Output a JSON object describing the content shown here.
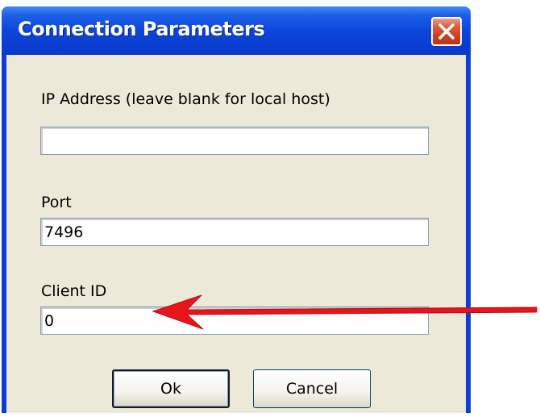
{
  "window": {
    "title": "Connection Parameters",
    "close_glyph": "✕"
  },
  "fields": {
    "ip_label": "IP Address (leave blank for local host)",
    "ip_value": "",
    "port_label": "Port",
    "port_value": "7496",
    "client_id_label": "Client ID",
    "client_id_value": "0"
  },
  "buttons": {
    "ok_label": "Ok",
    "cancel_label": "Cancel"
  },
  "annotation": {
    "arrow_color": "#e8141c",
    "points_to": "client-id-field"
  },
  "colors": {
    "titlebar": "#0a3ed6",
    "dialog_bg": "#ece9d8",
    "close_button": "#de5f3e"
  }
}
